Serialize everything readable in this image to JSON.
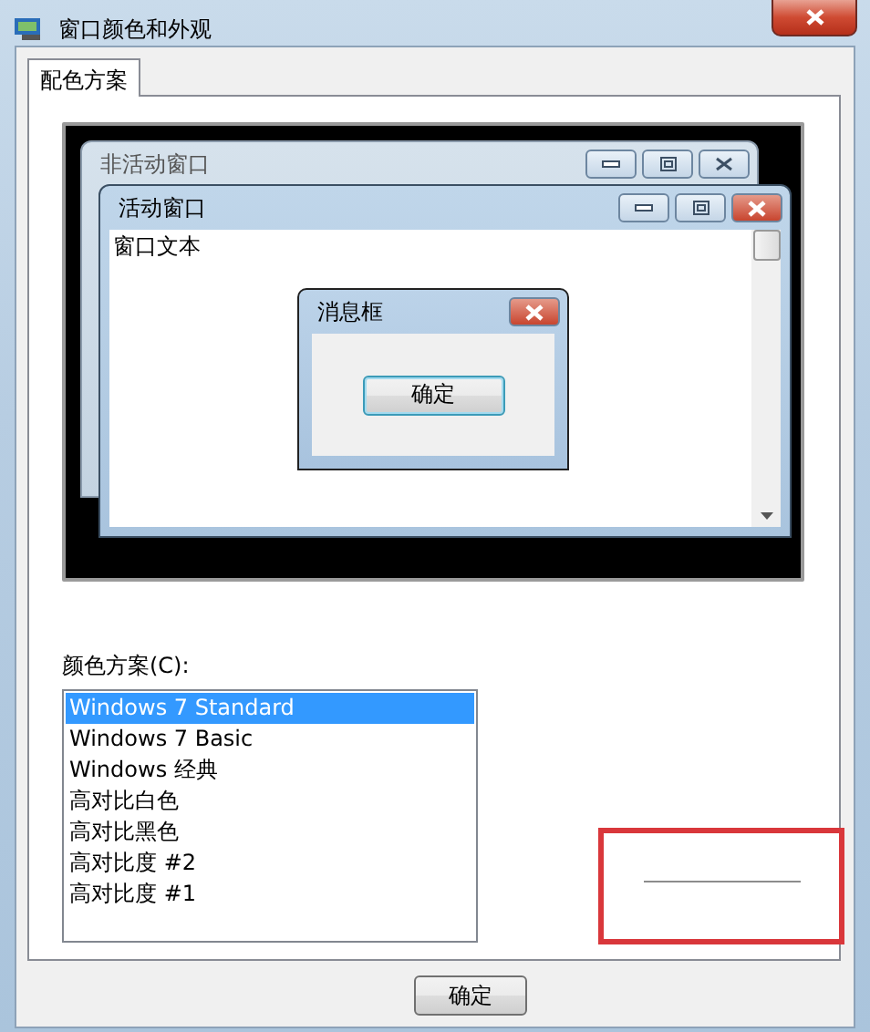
{
  "window": {
    "title": "窗口颜色和外观"
  },
  "tabs": [
    {
      "label": "配色方案",
      "selected": true
    }
  ],
  "preview": {
    "inactive_window": {
      "title": "非活动窗口"
    },
    "active_window": {
      "title": "活动窗口",
      "text": "窗口文本"
    },
    "message_box": {
      "title": "消息框",
      "button": "确定"
    }
  },
  "color_scheme": {
    "label": "颜色方案(C):",
    "items": [
      {
        "label": "Windows 7 Standard",
        "selected": true
      },
      {
        "label": "Windows 7 Basic",
        "selected": false
      },
      {
        "label": "Windows 经典",
        "selected": false
      },
      {
        "label": "高对比白色",
        "selected": false
      },
      {
        "label": "高对比黑色",
        "selected": false
      },
      {
        "label": "高对比度 #2",
        "selected": false
      },
      {
        "label": "高对比度 #1",
        "selected": false
      }
    ]
  },
  "annotation": {
    "kind": "box"
  },
  "buttons": [
    "确定"
  ]
}
